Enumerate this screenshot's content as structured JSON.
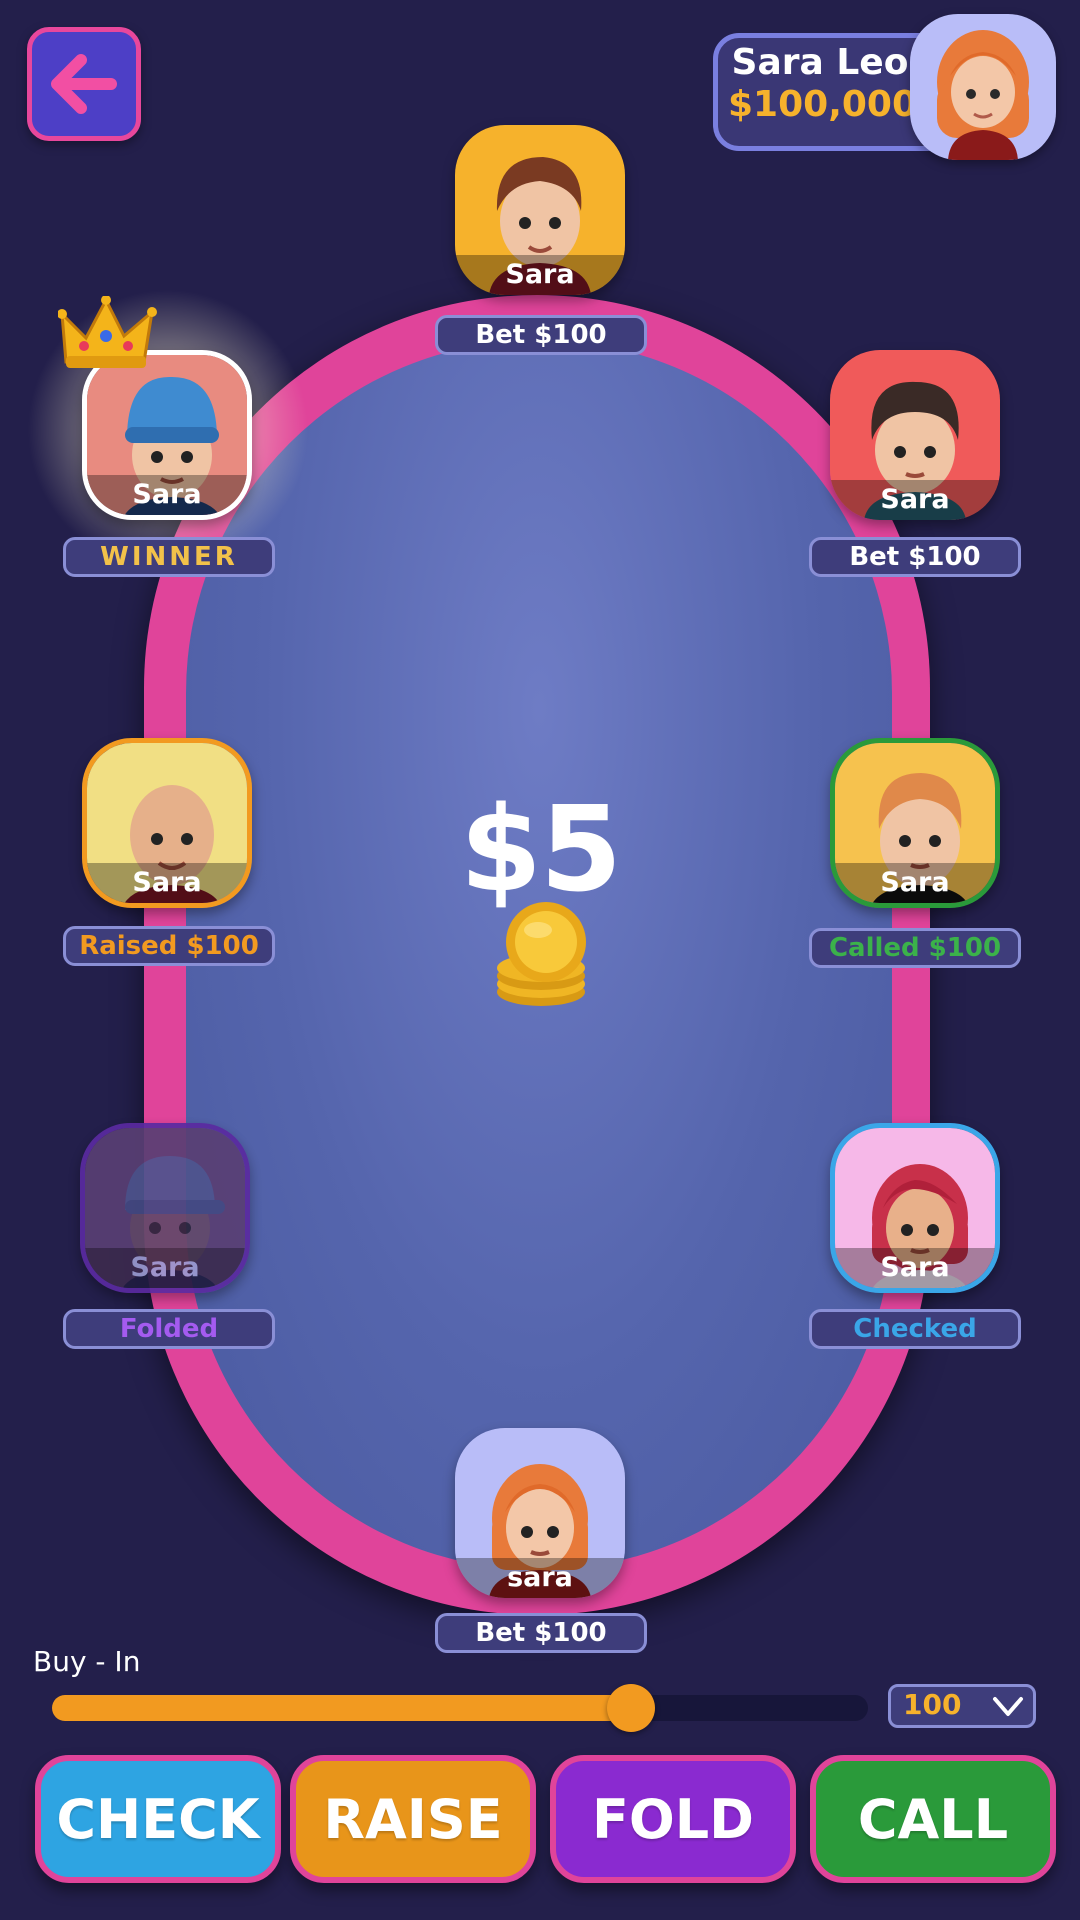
{
  "profile": {
    "name": "Sara Leo",
    "balance": "$100,000"
  },
  "pot": {
    "amount": "$5"
  },
  "seats": [
    {
      "name": "Sara",
      "status": "Bet $100",
      "status_color": "#ffffff",
      "border_color": "#f6b22c",
      "bg_color": "#f6b22c",
      "hair": "#7a3a22",
      "shirt": "#7a1622"
    },
    {
      "name": "Sara",
      "status": "WINNER",
      "status_color": "#f2c14a",
      "border_color": "#ffffff",
      "bg_color": "#e88b80",
      "hair": "#3f8bd0",
      "shirt": "#1e3d70"
    },
    {
      "name": "Sara",
      "status": "Bet $100",
      "status_color": "#ffffff",
      "border_color": "#f05a5a",
      "bg_color": "#f05a5a",
      "hair": "#3a2a26",
      "shirt": "#245a6a"
    },
    {
      "name": "Sara",
      "status": "Raised $100",
      "status_color": "#f29a20",
      "border_color": "#f29a20",
      "bg_color": "#f1df84",
      "hair": "#d9a07a",
      "shirt": "#7a1622"
    },
    {
      "name": "Sara",
      "status": "Called $100",
      "status_color": "#3bb24a",
      "border_color": "#2a9a3a",
      "bg_color": "#f6c24e",
      "hair": "#e0894a",
      "shirt": "#111111"
    },
    {
      "name": "Sara",
      "status": "Folded",
      "status_color": "#a45bf0",
      "border_color": "#5a2aa0",
      "bg_color": "#6b4a7a",
      "hair": "#3a4a9a",
      "shirt": "#2a2a5a"
    },
    {
      "name": "Sara",
      "status": "Checked",
      "status_color": "#3aa6e8",
      "border_color": "#3aa6e8",
      "bg_color": "#f6b8e8",
      "hair": "#c8304a",
      "shirt": "#f0e4f4"
    },
    {
      "name": "sara",
      "status": "Bet $100",
      "status_color": "#ffffff",
      "border_color": "#b9bdf8",
      "bg_color": "#b9bdf8",
      "hair": "#e87a3a",
      "shirt": "#8a1a1a"
    }
  ],
  "buy_in": {
    "label": "Buy - In",
    "value": "100",
    "level": 0.71
  },
  "actions": [
    {
      "label": "CHECK",
      "color": "#2ea4e2"
    },
    {
      "label": "RAISE",
      "color": "#e8951a"
    },
    {
      "label": "FOLD",
      "color": "#8a2ad0"
    },
    {
      "label": "CALL",
      "color": "#2a9a3a"
    }
  ]
}
